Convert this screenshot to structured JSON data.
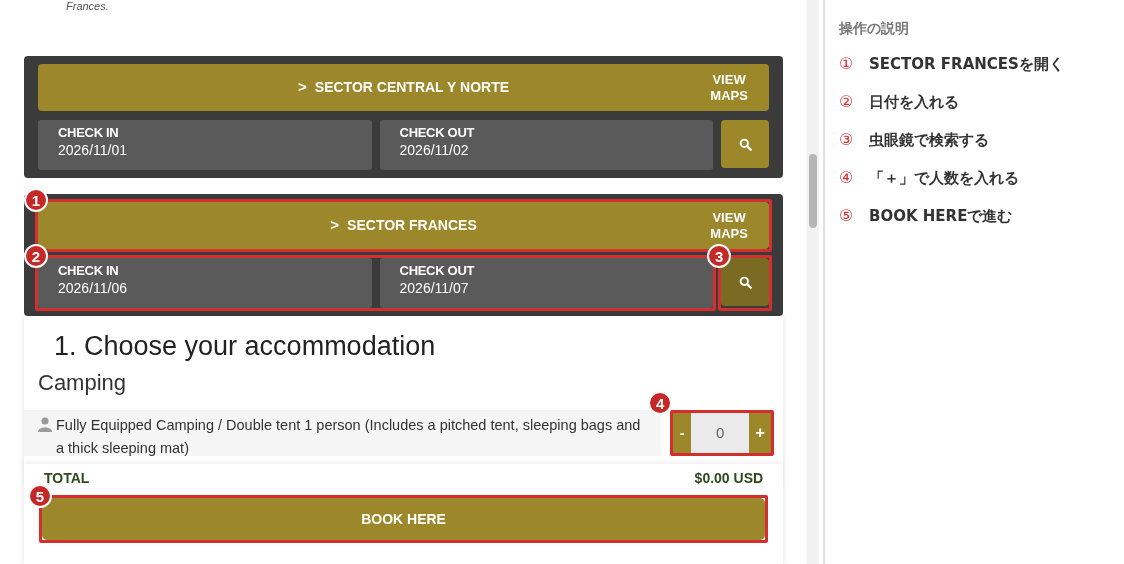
{
  "intro_text": "Frances.",
  "sectors": [
    {
      "name": "SECTOR CENTRAL Y NORTE",
      "chevron": ">",
      "maps_link": "VIEW MAPS",
      "check_in": {
        "label": "CHECK IN",
        "value": "2026/11/01"
      },
      "check_out": {
        "label": "CHECK OUT",
        "value": "2026/11/02"
      },
      "search_highlighted": false
    },
    {
      "name": "SECTOR FRANCES",
      "chevron": ">",
      "maps_link": "VIEW MAPS",
      "check_in": {
        "label": "CHECK IN",
        "value": "2026/11/06"
      },
      "check_out": {
        "label": "CHECK OUT",
        "value": "2026/11/07"
      },
      "search_highlighted": true,
      "header_callout": "1",
      "dates_callout": "2",
      "search_callout": "3"
    }
  ],
  "booking": {
    "heading": "1. Choose your accommodation",
    "category": "Camping",
    "items": [
      {
        "description": "Fully Equipped Camping / Double tent 1 person (Includes a pitched tent, sleeping bags and a thick sleeping mat)",
        "minus": "-",
        "quantity": "0",
        "plus": "+",
        "callout": "4"
      }
    ],
    "total_label": "TOTAL",
    "total_value": "$0.00 USD",
    "book_button": "BOOK HERE",
    "book_callout": "5"
  },
  "instructions": {
    "title": "操作の説明",
    "steps": [
      {
        "number": "①",
        "text": "SECTOR FRANCESを開く"
      },
      {
        "number": "②",
        "text": "日付を入れる"
      },
      {
        "number": "③",
        "text": "虫眼鏡で検索する"
      },
      {
        "number": "④",
        "text": "「＋」で人数を入れる"
      },
      {
        "number": "⑤",
        "text": "BOOK HEREで進む"
      }
    ]
  }
}
